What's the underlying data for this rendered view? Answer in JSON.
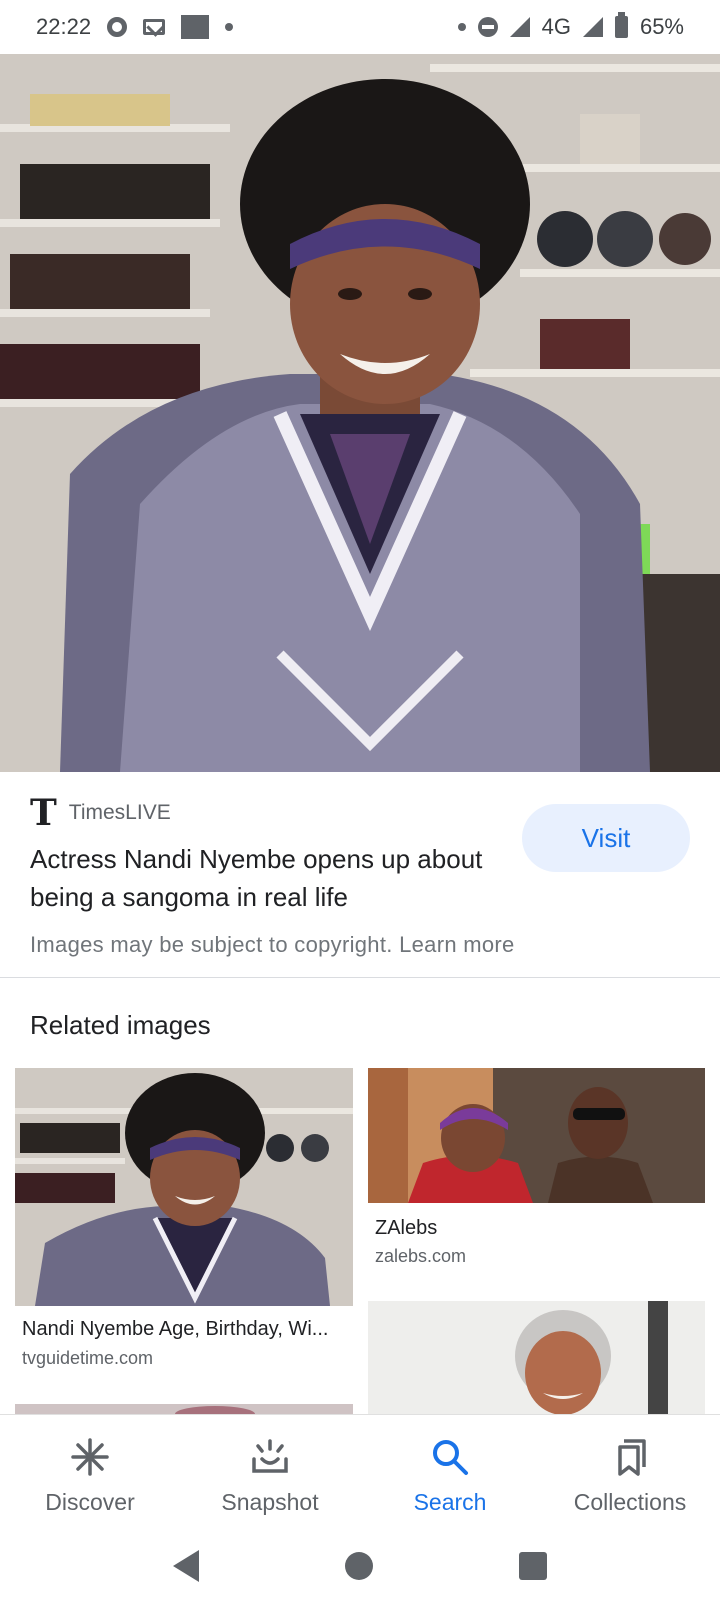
{
  "status_bar": {
    "time": "22:22",
    "network": "4G",
    "battery": "65%",
    "icons": [
      "chrome-icon",
      "gmail-icon",
      "image-icon",
      "dot-icon",
      "dnd-icon",
      "signal-icon",
      "battery-icon"
    ]
  },
  "result": {
    "source_name": "TimesLIVE",
    "source_logo": "T",
    "title": "Actress Nandi Nyembe opens up about being a sangoma in real life",
    "visit_label": "Visit",
    "copyright_text": "Images may be subject to copyright.",
    "learn_more": "Learn more"
  },
  "related": {
    "heading": "Related images",
    "items": [
      {
        "caption": "Nandi Nyembe Age, Birthday, Wi...",
        "domain": "tvguidetime.com"
      },
      {
        "caption": "ZAlebs",
        "domain": "zalebs.com"
      }
    ]
  },
  "bottom_nav": {
    "items": [
      {
        "label": "Discover",
        "icon": "discover-icon"
      },
      {
        "label": "Snapshot",
        "icon": "snapshot-icon"
      },
      {
        "label": "Search",
        "icon": "search-icon",
        "active": true
      },
      {
        "label": "Collections",
        "icon": "collections-icon"
      }
    ]
  },
  "colors": {
    "accent": "#1a73e8",
    "visit_bg": "#e8f0fe",
    "text_primary": "#202124",
    "text_secondary": "#5f6368"
  }
}
